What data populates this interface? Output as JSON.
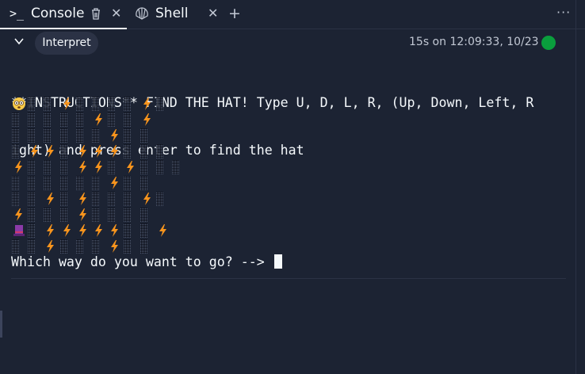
{
  "tabs": [
    {
      "label": "Console",
      "icon": "console-prompt-icon",
      "active": true
    },
    {
      "label": "Shell",
      "icon": "shell-icon",
      "active": false
    }
  ],
  "toolbar": {
    "interpret_label": "Interpret",
    "status_text": "15s on 12:09:33, 10/23",
    "status_color": "#0a9e3d"
  },
  "console": {
    "instructions_line1": "**INSTRUCTIONS** FIND THE HAT! Type U, D, L, R, (Up, Down, Left, R",
    "instructions_line2": "ight) and press enter to find the hat",
    "grid": [
      [
        "player",
        "field",
        "field",
        "hole",
        "field",
        "field",
        "field",
        "field",
        "hole",
        "field"
      ],
      [
        "field",
        "field",
        "field",
        "field",
        "field",
        "hole",
        "field",
        "field",
        "hole"
      ],
      [
        "field",
        "field",
        "field",
        "field",
        "field",
        "field",
        "hole",
        "field",
        "field"
      ],
      [
        "field",
        "hole",
        "hole",
        "field",
        "hole",
        "hole",
        "hole",
        "field",
        "field",
        "field"
      ],
      [
        "hole",
        "field",
        "field",
        "field",
        "hole",
        "hole",
        "field",
        "hole",
        "field",
        "field",
        "field"
      ],
      [
        "field",
        "field",
        "field",
        "field",
        "field",
        "field",
        "hole",
        "field",
        "field"
      ],
      [
        "field",
        "field",
        "hole",
        "field",
        "hole",
        "field",
        "field",
        "field",
        "hole",
        "field"
      ],
      [
        "hole",
        "field",
        "field",
        "field",
        "hole",
        "field",
        "field",
        "field",
        "field"
      ],
      [
        "hat",
        "field",
        "hole",
        "hole",
        "hole",
        "hole",
        "hole",
        "field",
        "field",
        "hole"
      ],
      [
        "field",
        "field",
        "hole",
        "field",
        "field",
        "field",
        "hole",
        "field",
        "field"
      ]
    ],
    "prompt": "Which way do you want to go? -->"
  },
  "colors": {
    "background": "#1c2333",
    "hole": "#f7941d",
    "hat": "#8b3aa8"
  }
}
